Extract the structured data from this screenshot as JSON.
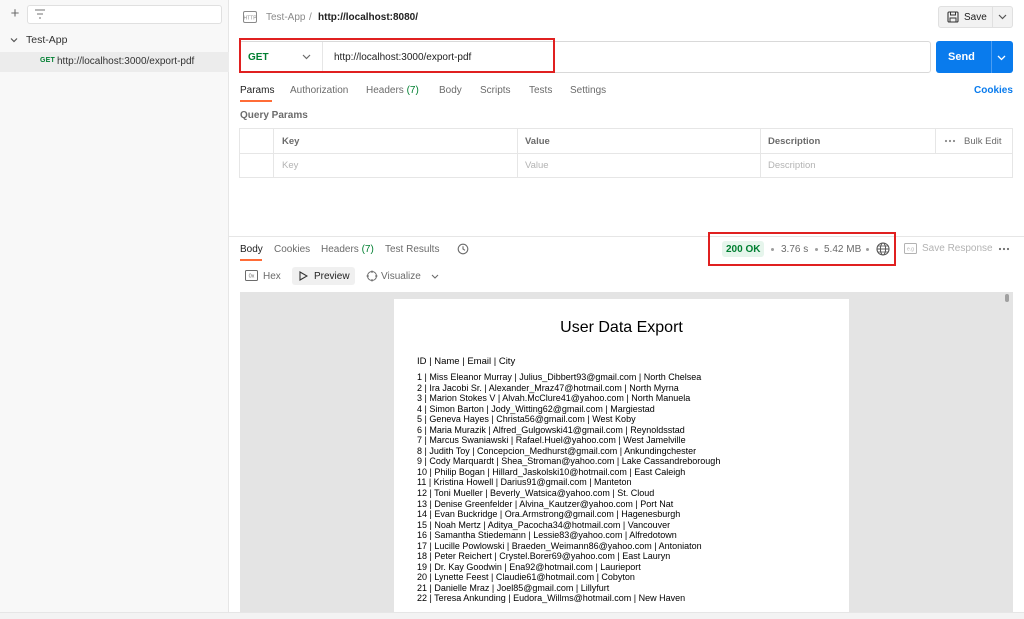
{
  "sidebar": {
    "collection_name": "Test-App",
    "request": {
      "method": "GET",
      "url": "http://localhost:3000/export-pdf"
    }
  },
  "header": {
    "breadcrumb_parent": "Test-App",
    "breadcrumb_separator": "/",
    "breadcrumb_current": "http://localhost:8080/",
    "save_label": "Save"
  },
  "request": {
    "method": "GET",
    "url": "http://localhost:3000/export-pdf",
    "send_label": "Send",
    "tabs": [
      {
        "label": "Params"
      },
      {
        "label": "Authorization"
      },
      {
        "label": "Headers",
        "count": "(7)"
      },
      {
        "label": "Body"
      },
      {
        "label": "Scripts"
      },
      {
        "label": "Tests"
      },
      {
        "label": "Settings"
      }
    ],
    "cookies_label": "Cookies",
    "query_params_title": "Query Params",
    "columns": [
      "Key",
      "Value",
      "Description"
    ],
    "placeholders": [
      "Key",
      "Value",
      "Description"
    ],
    "bulk_edit_label": "Bulk Edit"
  },
  "response": {
    "tabs": [
      {
        "label": "Body"
      },
      {
        "label": "Cookies"
      },
      {
        "label": "Headers",
        "count": "(7)"
      },
      {
        "label": "Test Results"
      }
    ],
    "status": "200 OK",
    "time": "3.76 s",
    "size": "5.42 MB",
    "save_response_label": "Save Response",
    "formats": {
      "hex": "Hex",
      "preview": "Preview",
      "visualize": "Visualize"
    }
  },
  "pdf": {
    "title": "User Data Export",
    "header": "ID | Name | Email | City",
    "rows": [
      "1 | Miss Eleanor Murray | Julius_Dibbert93@gmail.com | North Chelsea",
      "2 | Ira Jacobi Sr. | Alexander_Mraz47@hotmail.com | North Myrna",
      "3 | Marion Stokes V | Alvah.McClure41@yahoo.com | North Manuela",
      "4 | Simon Barton | Jody_Witting62@gmail.com | Margiestad",
      "5 | Geneva Hayes | Christa56@gmail.com | West Koby",
      "6 | Maria Murazik | Alfred_Gulgowski41@gmail.com | Reynoldsstad",
      "7 | Marcus Swaniawski | Rafael.Huel@yahoo.com | West Jamelville",
      "8 | Judith Toy | Concepcion_Medhurst@gmail.com | Ankundingchester",
      "9 | Cody Marquardt | Shea_Stroman@yahoo.com | Lake Cassandreborough",
      "10 | Philip Bogan | Hillard_Jaskolski10@hotmail.com | East Caleigh",
      "11 | Kristina Howell | Darius91@gmail.com | Manteton",
      "12 | Toni Mueller | Beverly_Watsica@yahoo.com | St. Cloud",
      "13 | Denise Greenfelder | Alvina_Kautzer@yahoo.com | Port Nat",
      "14 | Evan Buckridge | Ora.Armstrong@gmail.com | Hagenesburgh",
      "15 | Noah Mertz | Aditya_Pacocha34@hotmail.com | Vancouver",
      "16 | Samantha Stiedemann | Lessie83@yahoo.com | Alfredotown",
      "17 | Lucille Powlowski | Braeden_Weimann86@yahoo.com | Antoniaton",
      "18 | Peter Reichert | Crystel.Borer69@yahoo.com | East Lauryn",
      "19 | Dr. Kay Goodwin | Ena92@hotmail.com | Laurieport",
      "20 | Lynette Feest | Claudie61@hotmail.com | Cobyton",
      "21 | Danielle Mraz | Joel85@gmail.com | Lillyfurt",
      "22 | Teresa Ankunding | Eudora_Willms@hotmail.com | New Haven"
    ]
  },
  "colors": {
    "accent_orange": "#ff6c37",
    "send_blue": "#097bed",
    "method_green": "#007f31",
    "highlight_red": "#e02020"
  }
}
